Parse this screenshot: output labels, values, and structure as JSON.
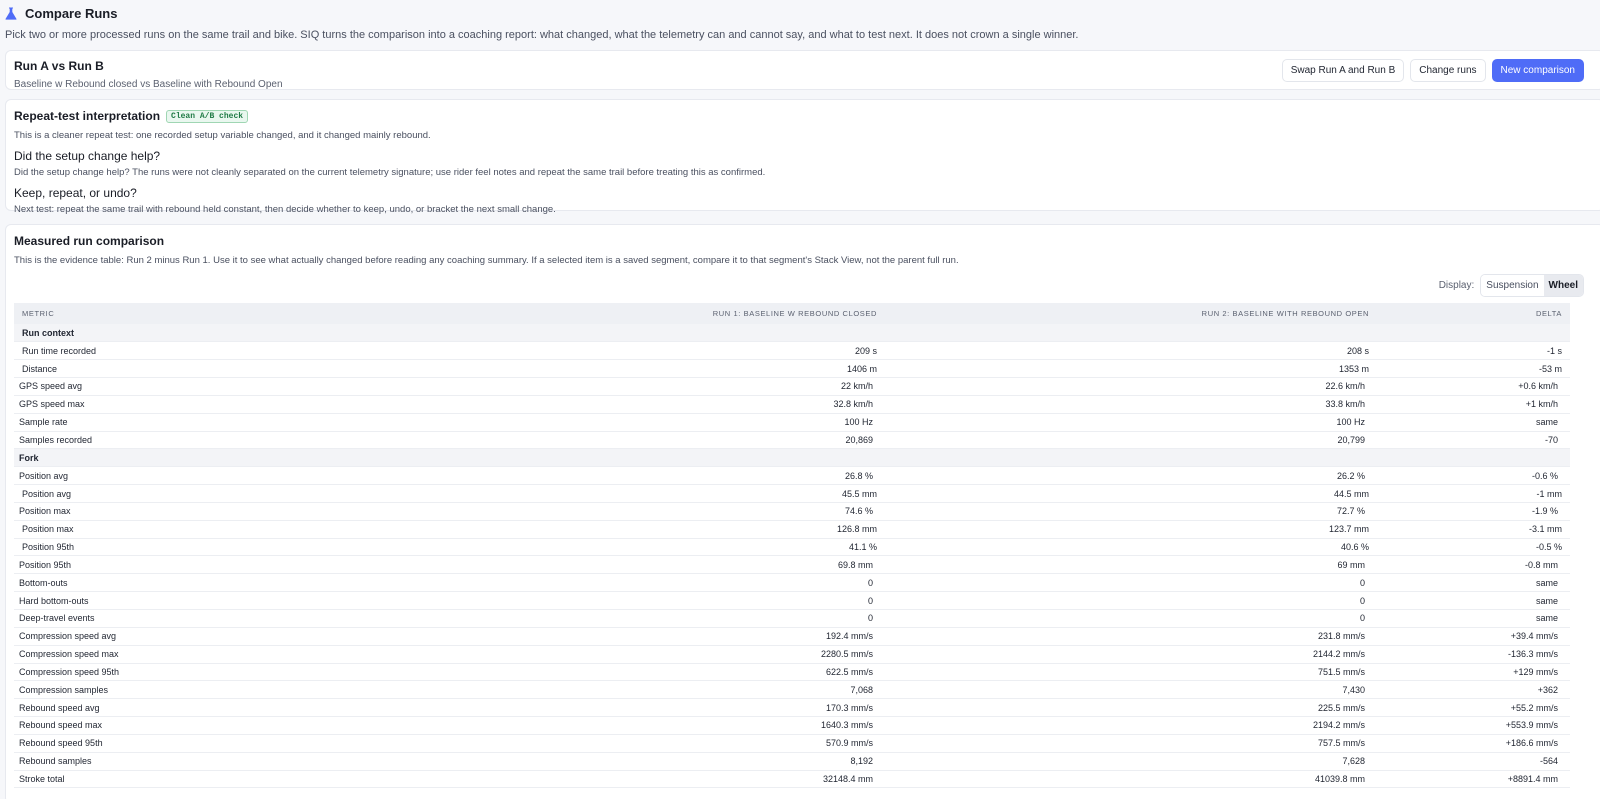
{
  "page": {
    "title": "Compare Runs",
    "intro": "Pick two or more processed runs on the same trail and bike. SIQ turns the comparison into a coaching report: what changed, what the telemetry can and cannot say, and what to test next. It does not crown a single winner."
  },
  "runs": {
    "title": "Run A vs Run B",
    "subtitle": "Baseline w Rebound closed vs Baseline with Rebound Open",
    "actions": {
      "swap": "Swap Run A and Run B",
      "change": "Change runs",
      "new": "New comparison"
    }
  },
  "interpretation": {
    "title": "Repeat-test interpretation",
    "badge": "Clean A/B check",
    "text": "This is a cleaner repeat test: one recorded setup variable changed, and it changed mainly rebound.",
    "q1_title": "Did the setup change help?",
    "q1_text": "Did the setup change help? The runs were not cleanly separated on the current telemetry signature; use rider feel notes and repeat the same trail before treating this as confirmed.",
    "q2_title": "Keep, repeat, or undo?",
    "q2_text": "Next test: repeat the same trail with rebound held constant, then decide whether to keep, undo, or bracket the next small change."
  },
  "measured": {
    "title": "Measured run comparison",
    "subtitle": "This is the evidence table: Run 2 minus Run 1. Use it to see what actually changed before reading any coaching summary. If a selected item is a saved segment, compare it to that segment's Stack View, not the parent full run.",
    "display_label": "Display:",
    "display_options": [
      "Suspension",
      "Wheel"
    ],
    "display_selected": "Wheel",
    "columns": {
      "metric": "Metric",
      "run1": "Run 1: Baseline w Rebound closed",
      "run2": "Run 2: Baseline with Rebound Open",
      "delta": "Delta"
    },
    "rows": [
      {
        "type": "section",
        "label": "Run context"
      },
      {
        "metric": "Run time recorded",
        "r1": "209 s",
        "r2": "208 s",
        "d": "-1 s"
      },
      {
        "metric": "Distance",
        "r1": "1406 m",
        "r2": "1353 m",
        "d": "-53 m"
      },
      {
        "metric": "GPS speed avg",
        "r1": "22 km/h",
        "r2": "22.6 km/h",
        "d": "+0.6 km/h",
        "shift": true
      },
      {
        "metric": "GPS speed max",
        "r1": "32.8 km/h",
        "r2": "33.8 km/h",
        "d": "+1 km/h",
        "shift": true
      },
      {
        "metric": "Sample rate",
        "r1": "100 Hz",
        "r2": "100 Hz",
        "d": "same",
        "shift": true
      },
      {
        "metric": "Samples recorded",
        "r1": "20,869",
        "r2": "20,799",
        "d": "-70",
        "shift": true
      },
      {
        "type": "section",
        "label": "Fork",
        "shift": true
      },
      {
        "metric": "Position avg",
        "r1": "26.8 %",
        "r2": "26.2 %",
        "d": "-0.6 %",
        "shift": true
      },
      {
        "metric": "Position avg",
        "r1": "45.5 mm",
        "r2": "44.5 mm",
        "d": "-1 mm"
      },
      {
        "metric": "Position max",
        "r1": "74.6 %",
        "r2": "72.7 %",
        "d": "-1.9 %",
        "shift": true
      },
      {
        "metric": "Position max",
        "r1": "126.8 mm",
        "r2": "123.7 mm",
        "d": "-3.1 mm"
      },
      {
        "metric": "Position 95th",
        "r1": "41.1 %",
        "r2": "40.6 %",
        "d": "-0.5 %"
      },
      {
        "metric": "Position 95th",
        "r1": "69.8 mm",
        "r2": "69 mm",
        "d": "-0.8 mm",
        "shift": true
      },
      {
        "metric": "Bottom-outs",
        "r1": "0",
        "r2": "0",
        "d": "same",
        "shift": true
      },
      {
        "metric": "Hard bottom-outs",
        "r1": "0",
        "r2": "0",
        "d": "same",
        "shift": true
      },
      {
        "metric": "Deep-travel events",
        "r1": "0",
        "r2": "0",
        "d": "same",
        "shift": true
      },
      {
        "metric": "Compression speed avg",
        "r1": "192.4 mm/s",
        "r2": "231.8 mm/s",
        "d": "+39.4 mm/s",
        "shift": true
      },
      {
        "metric": "Compression speed max",
        "r1": "2280.5 mm/s",
        "r2": "2144.2 mm/s",
        "d": "-136.3 mm/s",
        "shift": true
      },
      {
        "metric": "Compression speed 95th",
        "r1": "622.5 mm/s",
        "r2": "751.5 mm/s",
        "d": "+129 mm/s",
        "shift": true
      },
      {
        "metric": "Compression samples",
        "r1": "7,068",
        "r2": "7,430",
        "d": "+362",
        "shift": true
      },
      {
        "metric": "Rebound speed avg",
        "r1": "170.3 mm/s",
        "r2": "225.5 mm/s",
        "d": "+55.2 mm/s",
        "shift": true
      },
      {
        "metric": "Rebound speed max",
        "r1": "1640.3 mm/s",
        "r2": "2194.2 mm/s",
        "d": "+553.9 mm/s",
        "shift": true
      },
      {
        "metric": "Rebound speed 95th",
        "r1": "570.9 mm/s",
        "r2": "757.5 mm/s",
        "d": "+186.6 mm/s",
        "shift": true
      },
      {
        "metric": "Rebound samples",
        "r1": "8,192",
        "r2": "7,628",
        "d": "-564",
        "shift": true
      },
      {
        "metric": "Stroke total",
        "r1": "32148.4 mm",
        "r2": "41039.8 mm",
        "d": "+8891.4 mm",
        "shift": true
      }
    ]
  },
  "colors": {
    "accent": "#4f6cf7",
    "badge_green": "#1f7a45",
    "background": "#f6f7fa"
  }
}
